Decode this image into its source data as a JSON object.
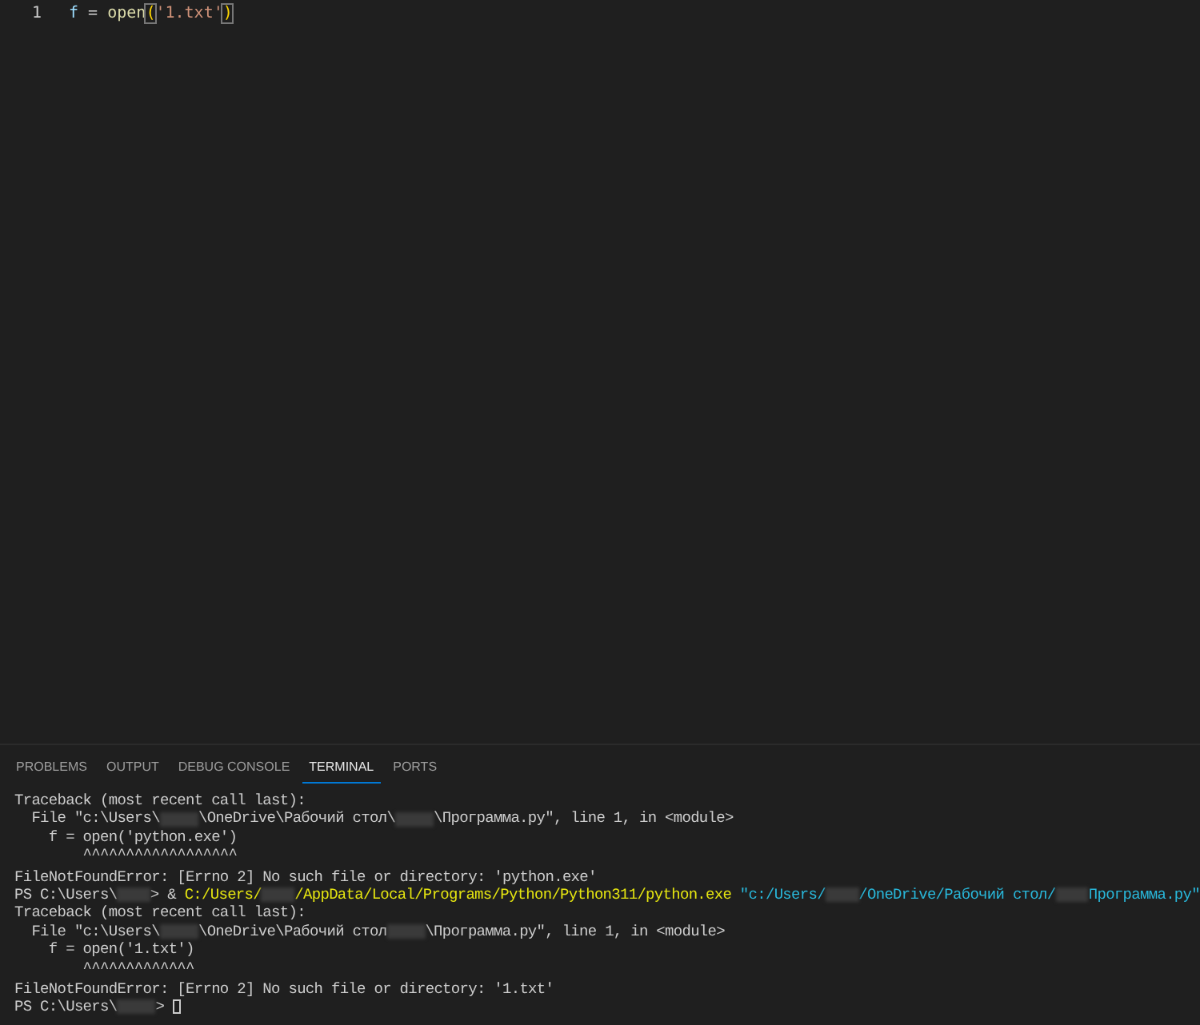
{
  "editor": {
    "lines": [
      {
        "number": "1",
        "active": true,
        "tokens": [
          {
            "kind": "variable",
            "text": "f"
          },
          {
            "kind": "plain",
            "text": " = "
          },
          {
            "kind": "function",
            "text": "open"
          },
          {
            "kind": "bracket",
            "text": "("
          },
          {
            "kind": "string",
            "text": "'1.txt'"
          },
          {
            "kind": "bracket",
            "text": ")"
          }
        ]
      }
    ]
  },
  "panel": {
    "tabs": [
      {
        "label": "PROBLEMS",
        "selected": false
      },
      {
        "label": "OUTPUT",
        "selected": false
      },
      {
        "label": "DEBUG CONSOLE",
        "selected": false
      },
      {
        "label": "TERMINAL",
        "selected": true
      },
      {
        "label": "PORTS",
        "selected": false
      }
    ],
    "terminal": {
      "lines": [
        [
          {
            "kind": "plain",
            "text": "Traceback (most recent call last):"
          }
        ],
        [
          {
            "kind": "plain",
            "text": "  File \"c:\\Users\\"
          },
          {
            "kind": "redacted"
          },
          {
            "kind": "plain",
            "text": "\\OneDrive\\Рабочий стол\\"
          },
          {
            "kind": "redacted"
          },
          {
            "kind": "plain",
            "text": "\\Программа.py\", line 1, in <module>"
          }
        ],
        [
          {
            "kind": "plain",
            "text": "    f = open('python.exe')"
          }
        ],
        [
          {
            "kind": "plain",
            "text": "        ^^^^^^^^^^^^^^^^^^"
          }
        ],
        [
          {
            "kind": "plain",
            "text": "FileNotFoundError: [Errno 2] No such file or directory: 'python.exe'"
          }
        ],
        [
          {
            "kind": "plain",
            "text": "PS C:\\Users\\"
          },
          {
            "kind": "redacted"
          },
          {
            "kind": "plain",
            "text": "> & "
          },
          {
            "kind": "command",
            "text": "C:/Users/"
          },
          {
            "kind": "redacted"
          },
          {
            "kind": "command",
            "text": "/AppData/Local/Programs/Python/Python311/python.exe"
          },
          {
            "kind": "string",
            "text": " \"c:/Users/"
          },
          {
            "kind": "redacted"
          },
          {
            "kind": "string",
            "text": "/OneDrive/Рабочий стол/"
          },
          {
            "kind": "redacted"
          },
          {
            "kind": "string",
            "text": "Программа.py\""
          }
        ],
        [
          {
            "kind": "plain",
            "text": "Traceback (most recent call last):"
          }
        ],
        [
          {
            "kind": "plain",
            "text": "  File \"c:\\Users\\"
          },
          {
            "kind": "redacted"
          },
          {
            "kind": "plain",
            "text": "\\OneDrive\\Рабочий стол"
          },
          {
            "kind": "redacted"
          },
          {
            "kind": "plain",
            "text": "\\Программа.py\", line 1, in <module>"
          }
        ],
        [
          {
            "kind": "plain",
            "text": "    f = open('1.txt')"
          }
        ],
        [
          {
            "kind": "plain",
            "text": "        ^^^^^^^^^^^^^"
          }
        ],
        [
          {
            "kind": "plain",
            "text": "FileNotFoundError: [Errno 2] No such file or directory: '1.txt'"
          }
        ],
        [
          {
            "kind": "plain",
            "text": "PS C:\\Users\\"
          },
          {
            "kind": "redacted"
          },
          {
            "kind": "plain",
            "text": "> "
          },
          {
            "kind": "cursor"
          }
        ]
      ]
    }
  }
}
